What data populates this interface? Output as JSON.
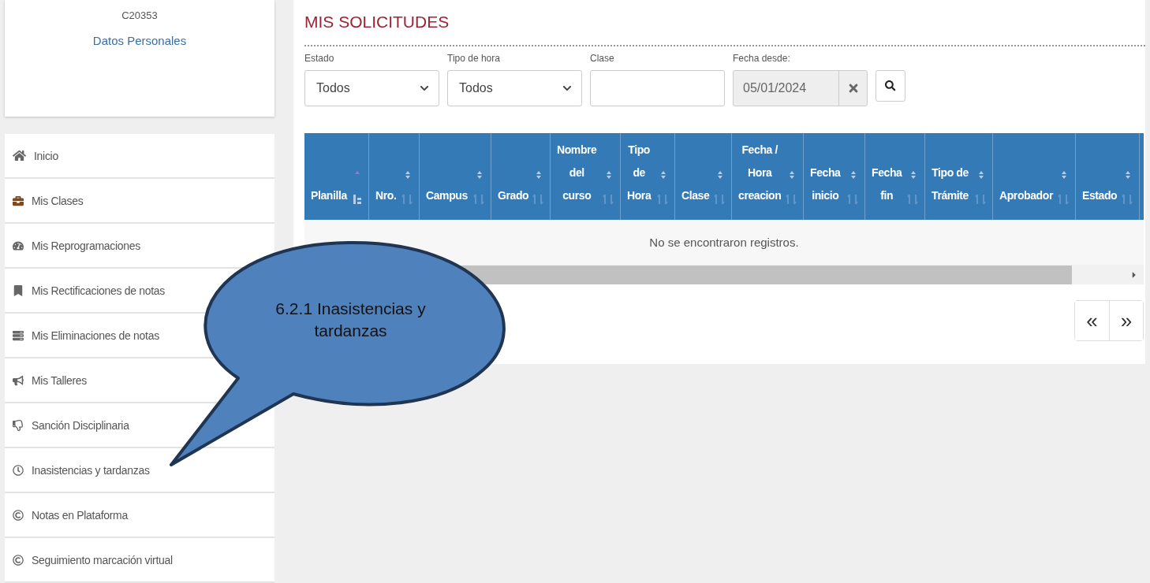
{
  "profile": {
    "code": "C20353",
    "link": "Datos Personales"
  },
  "menu": [
    {
      "label": "Inicio",
      "selected": false
    },
    {
      "label": "Mis Clases",
      "selected": false
    },
    {
      "label": "Mis Reprogramaciones",
      "selected": false
    },
    {
      "label": "Mis Rectificaciones de notas",
      "selected": false
    },
    {
      "label": "Mis Eliminaciones de notas",
      "selected": false
    },
    {
      "label": "Mis Talleres",
      "selected": false
    },
    {
      "label": "Sanción Disciplinaria",
      "selected": false
    },
    {
      "label": "Inasistencias y tardanzas",
      "selected": false
    },
    {
      "label": "Notas en Plataforma",
      "selected": false
    },
    {
      "label": "Seguimiento marcación virtual",
      "selected": false
    }
  ],
  "title": "MIS SOLICITUDES",
  "filters": [
    {
      "kind": "select",
      "label": "Estado",
      "value": "Todos"
    },
    {
      "kind": "select",
      "label": "Tipo de hora",
      "value": "Todos"
    },
    {
      "kind": "text",
      "label": "Clase"
    },
    {
      "kind": "date",
      "label": "Fecha desde:",
      "value": "05/01/2024"
    }
  ],
  "table": {
    "columns": [
      {
        "label": "Planilla",
        "sorted": true
      },
      {
        "label": "Nro.",
        "sorted": false
      },
      {
        "label": "Campus",
        "sorted": false
      },
      {
        "label": "Grado",
        "sorted": false
      },
      {
        "label": "Nombre\ndel\ncurso",
        "sorted": false
      },
      {
        "label": "Tipo\nde\nHora",
        "sorted": false
      },
      {
        "label": "Clase",
        "sorted": false
      },
      {
        "label": "Fecha /\nHora\ncreacion",
        "sorted": false
      },
      {
        "label": "Fecha\ninicio",
        "sorted": false
      },
      {
        "label": "Fecha\nfin",
        "sorted": false
      },
      {
        "label": "Tipo de\nTrámite",
        "sorted": false
      },
      {
        "label": "Aprobador",
        "sorted": false
      },
      {
        "label": "Estado",
        "sorted": false
      }
    ],
    "empty_message": "No se encontraron registros."
  },
  "pagination": {
    "prev": "«",
    "next": "»"
  },
  "callout": {
    "text": "6.2.1 Inasistencias y tardanzas"
  }
}
